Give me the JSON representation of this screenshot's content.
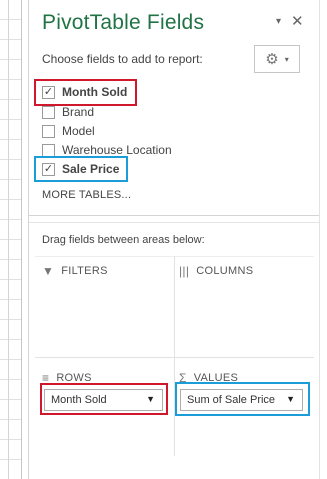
{
  "panel": {
    "title": "PivotTable Fields",
    "dropdown_icon": "▾",
    "close_icon": "✕",
    "choose_label": "Choose fields to add to report:",
    "gear_icon": "⚙",
    "gear_dropdown_icon": "▾"
  },
  "fields": [
    {
      "label": "Month Sold",
      "checked": true,
      "check_glyph": "✓"
    },
    {
      "label": "Brand",
      "checked": false,
      "check_glyph": ""
    },
    {
      "label": "Model",
      "checked": false,
      "check_glyph": ""
    },
    {
      "label": "Warehouse Location",
      "checked": false,
      "check_glyph": ""
    },
    {
      "label": "Sale Price",
      "checked": true,
      "check_glyph": "✓"
    }
  ],
  "more_tables": "MORE TABLES...",
  "drag_label": "Drag fields between areas below:",
  "areas": {
    "filters": {
      "icon": "▼",
      "label": "FILTERS"
    },
    "columns": {
      "icon": "|||",
      "label": "COLUMNS"
    },
    "rows": {
      "icon": "≡",
      "label": "ROWS",
      "item": "Month Sold",
      "item_arrow": "▼"
    },
    "values": {
      "icon": "Σ",
      "label": "VALUES",
      "item": "Sum of Sale Price",
      "item_arrow": "▼"
    }
  },
  "highlight_colors": {
    "red": "#d1172c",
    "blue": "#1a9dd9"
  },
  "accent_color": "#217346"
}
